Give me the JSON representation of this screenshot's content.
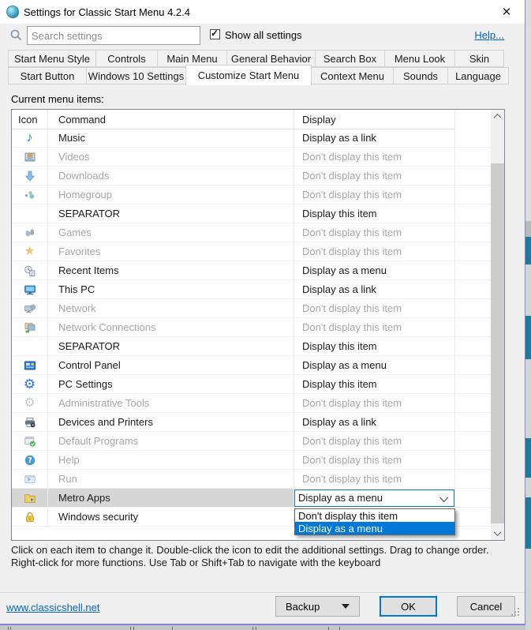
{
  "window": {
    "title": "Settings for Classic Start Menu 4.2.4",
    "close_glyph": "×"
  },
  "toolbar": {
    "search_placeholder": "Search settings",
    "show_all_label": "Show all settings",
    "show_all_checked": true,
    "help_label": "Help..."
  },
  "tabs": {
    "row1": [
      "Start Menu Style",
      "Controls",
      "Main Menu",
      "General Behavior",
      "Search Box",
      "Menu Look",
      "Skin"
    ],
    "row2": [
      {
        "label": "Start Button",
        "active": false
      },
      {
        "label": "Windows 10 Settings",
        "active": false
      },
      {
        "label": "Customize Start Menu",
        "active": true
      },
      {
        "label": "Context Menu",
        "active": false
      },
      {
        "label": "Sounds",
        "active": false
      },
      {
        "label": "Language",
        "active": false
      }
    ]
  },
  "content": {
    "list_label": "Current menu items:",
    "table": {
      "headers": [
        "Icon",
        "Command",
        "Display"
      ],
      "rows": [
        {
          "icon": "music-note-icon",
          "command": "Music",
          "display": "Display as a link",
          "state": "enabled"
        },
        {
          "icon": "videos-icon",
          "command": "Videos",
          "display": "Don't display this item",
          "state": "disabled"
        },
        {
          "icon": "downloads-icon",
          "command": "Downloads",
          "display": "Don't display this item",
          "state": "disabled"
        },
        {
          "icon": "homegroup-icon",
          "command": "Homegroup",
          "display": "Don't display this item",
          "state": "disabled"
        },
        {
          "icon": "",
          "command": "SEPARATOR",
          "display": "Display this item",
          "state": "enabled"
        },
        {
          "icon": "games-icon",
          "command": "Games",
          "display": "Don't display this item",
          "state": "disabled"
        },
        {
          "icon": "favorites-icon",
          "command": "Favorites",
          "display": "Don't display this item",
          "state": "disabled"
        },
        {
          "icon": "recent-items-icon",
          "command": "Recent Items",
          "display": "Display as a menu",
          "state": "enabled"
        },
        {
          "icon": "this-pc-icon",
          "command": "This PC",
          "display": "Display as a link",
          "state": "enabled"
        },
        {
          "icon": "network-icon",
          "command": "Network",
          "display": "Don't display this item",
          "state": "disabled"
        },
        {
          "icon": "network-connections-icon",
          "command": "Network Connections",
          "display": "Don't display this item",
          "state": "disabled"
        },
        {
          "icon": "",
          "command": "SEPARATOR",
          "display": "Display this item",
          "state": "enabled"
        },
        {
          "icon": "control-panel-icon",
          "command": "Control Panel",
          "display": "Display as a menu",
          "state": "enabled"
        },
        {
          "icon": "pc-settings-icon",
          "command": "PC Settings",
          "display": "Display this item",
          "state": "enabled"
        },
        {
          "icon": "administrative-tools-icon",
          "command": "Administrative Tools",
          "display": "Don't display this item",
          "state": "disabled"
        },
        {
          "icon": "devices-printers-icon",
          "command": "Devices and Printers",
          "display": "Display as a link",
          "state": "enabled"
        },
        {
          "icon": "default-programs-icon",
          "command": "Default Programs",
          "display": "Don't display this item",
          "state": "disabled"
        },
        {
          "icon": "help-icon",
          "command": "Help",
          "display": "Don't display this item",
          "state": "disabled"
        },
        {
          "icon": "run-icon",
          "command": "Run",
          "display": "Don't display this item",
          "state": "disabled"
        },
        {
          "icon": "metro-apps-icon",
          "command": "Metro Apps",
          "display": "Display as a menu",
          "state": "selected",
          "combobox": true
        },
        {
          "icon": "windows-security-icon",
          "command": "Windows security",
          "display": "",
          "state": "enabled"
        }
      ]
    },
    "dropdown": {
      "value": "Display as a menu",
      "options": [
        {
          "label": "Don't display this item",
          "selected": false
        },
        {
          "label": "Display as a menu",
          "selected": true
        }
      ]
    },
    "instructions": [
      "Click on each item to change it. Double-click the icon to edit the additional settings. Drag to change order.",
      "Right-click for more functions. Use Tab or Shift+Tab to navigate with the keyboard"
    ]
  },
  "footer": {
    "site_link": "www.classicshell.net",
    "backup_label": "Backup",
    "ok_label": "OK",
    "cancel_label": "Cancel"
  },
  "colors": {
    "accent": "#0078d7",
    "disabled_text": "#a7a7a7",
    "selected_row_bg": "#d6d6d6",
    "link": "#0563c1"
  }
}
